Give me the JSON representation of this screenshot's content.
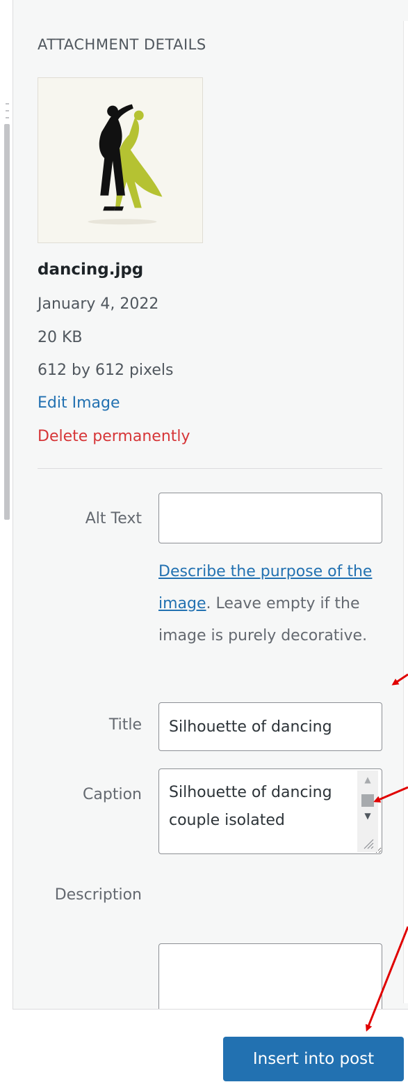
{
  "panel": {
    "section_title": "ATTACHMENT DETAILS"
  },
  "thumbnail": {
    "icon": "dancing-couple-silhouette",
    "colors": {
      "background": "#f7f6ef",
      "figure_dark": "#111111",
      "figure_accent": "#b5c232"
    }
  },
  "file": {
    "name": "dancing.jpg",
    "date": "January 4, 2022",
    "size": "20 KB",
    "dimensions": "612 by 612 pixels"
  },
  "actions": {
    "edit_label": "Edit Image",
    "delete_label": "Delete permanently"
  },
  "fields": {
    "alt_text": {
      "label": "Alt Text",
      "value": "",
      "help_link": "Describe the purpose of the image",
      "help_rest": ". Leave empty if the image is purely decorative."
    },
    "title": {
      "label": "Title",
      "value": "Silhouette of dancing"
    },
    "caption": {
      "label": "Caption",
      "value": "Silhouette of dancing couple isolated"
    },
    "description": {
      "label": "Description",
      "value": ""
    }
  },
  "footer": {
    "insert_label": "Insert into post"
  },
  "colors": {
    "accent": "#2271b1",
    "danger": "#d63638",
    "annotation": "#e00000"
  }
}
